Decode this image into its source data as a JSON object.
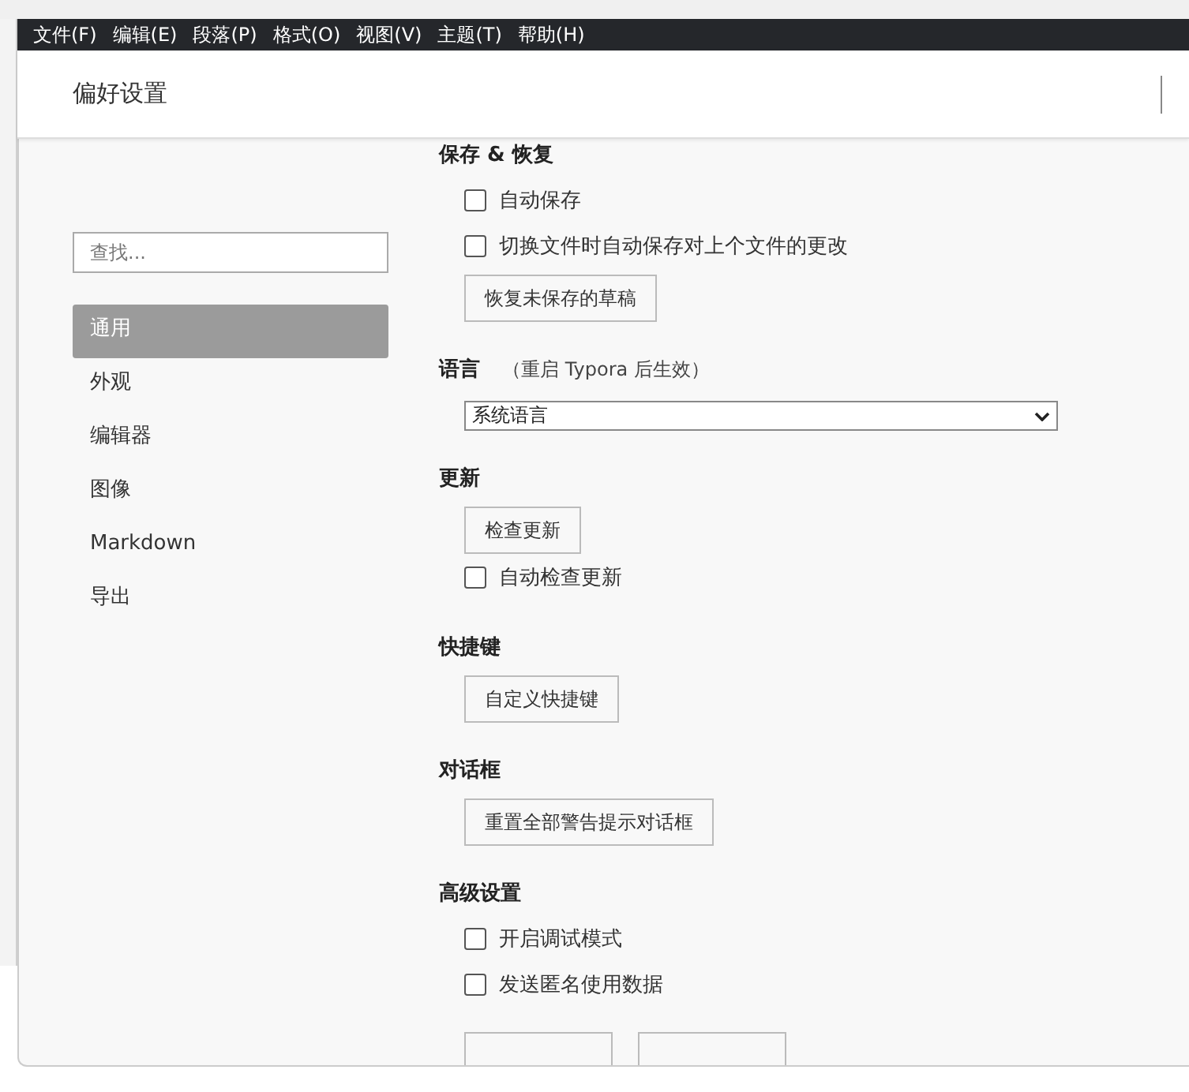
{
  "menu_bar": [
    "文件(F)",
    "编辑(E)",
    "段落(P)",
    "格式(O)",
    "视图(V)",
    "主题(T)",
    "帮助(H)"
  ],
  "dialog": {
    "title": "偏好设置"
  },
  "search": {
    "placeholder": "查找..."
  },
  "nav": [
    {
      "label": "通用",
      "selected": true
    },
    {
      "label": "外观",
      "selected": false
    },
    {
      "label": "编辑器",
      "selected": false
    },
    {
      "label": "图像",
      "selected": false
    },
    {
      "label": "Markdown",
      "selected": false
    },
    {
      "label": "导出",
      "selected": false
    }
  ],
  "sections": [
    {
      "heading": "保存 & 恢复",
      "items": [
        {
          "kind": "checkbox",
          "label": "自动保存",
          "checked": false
        },
        {
          "kind": "checkbox",
          "label": "切换文件时自动保存对上个文件的更改",
          "checked": false
        },
        {
          "kind": "button",
          "label": "恢复未保存的草稿"
        }
      ]
    },
    {
      "heading": "语言",
      "note": "（重启 Typora 后生效）",
      "items": [
        {
          "kind": "select",
          "value": "系统语言"
        }
      ]
    },
    {
      "heading": "更新",
      "items": [
        {
          "kind": "button",
          "label": "检查更新"
        },
        {
          "kind": "checkbox",
          "label": "自动检查更新",
          "checked": false
        }
      ]
    },
    {
      "heading": "快捷键",
      "items": [
        {
          "kind": "button",
          "label": "自定义快捷键"
        }
      ]
    },
    {
      "heading": "对话框",
      "items": [
        {
          "kind": "button",
          "label": "重置全部警告提示对话框"
        }
      ]
    },
    {
      "heading": "高级设置",
      "items": [
        {
          "kind": "checkbox",
          "label": "开启调试模式",
          "checked": false
        },
        {
          "kind": "checkbox",
          "label": "发送匿名使用数据",
          "checked": false
        }
      ]
    }
  ]
}
